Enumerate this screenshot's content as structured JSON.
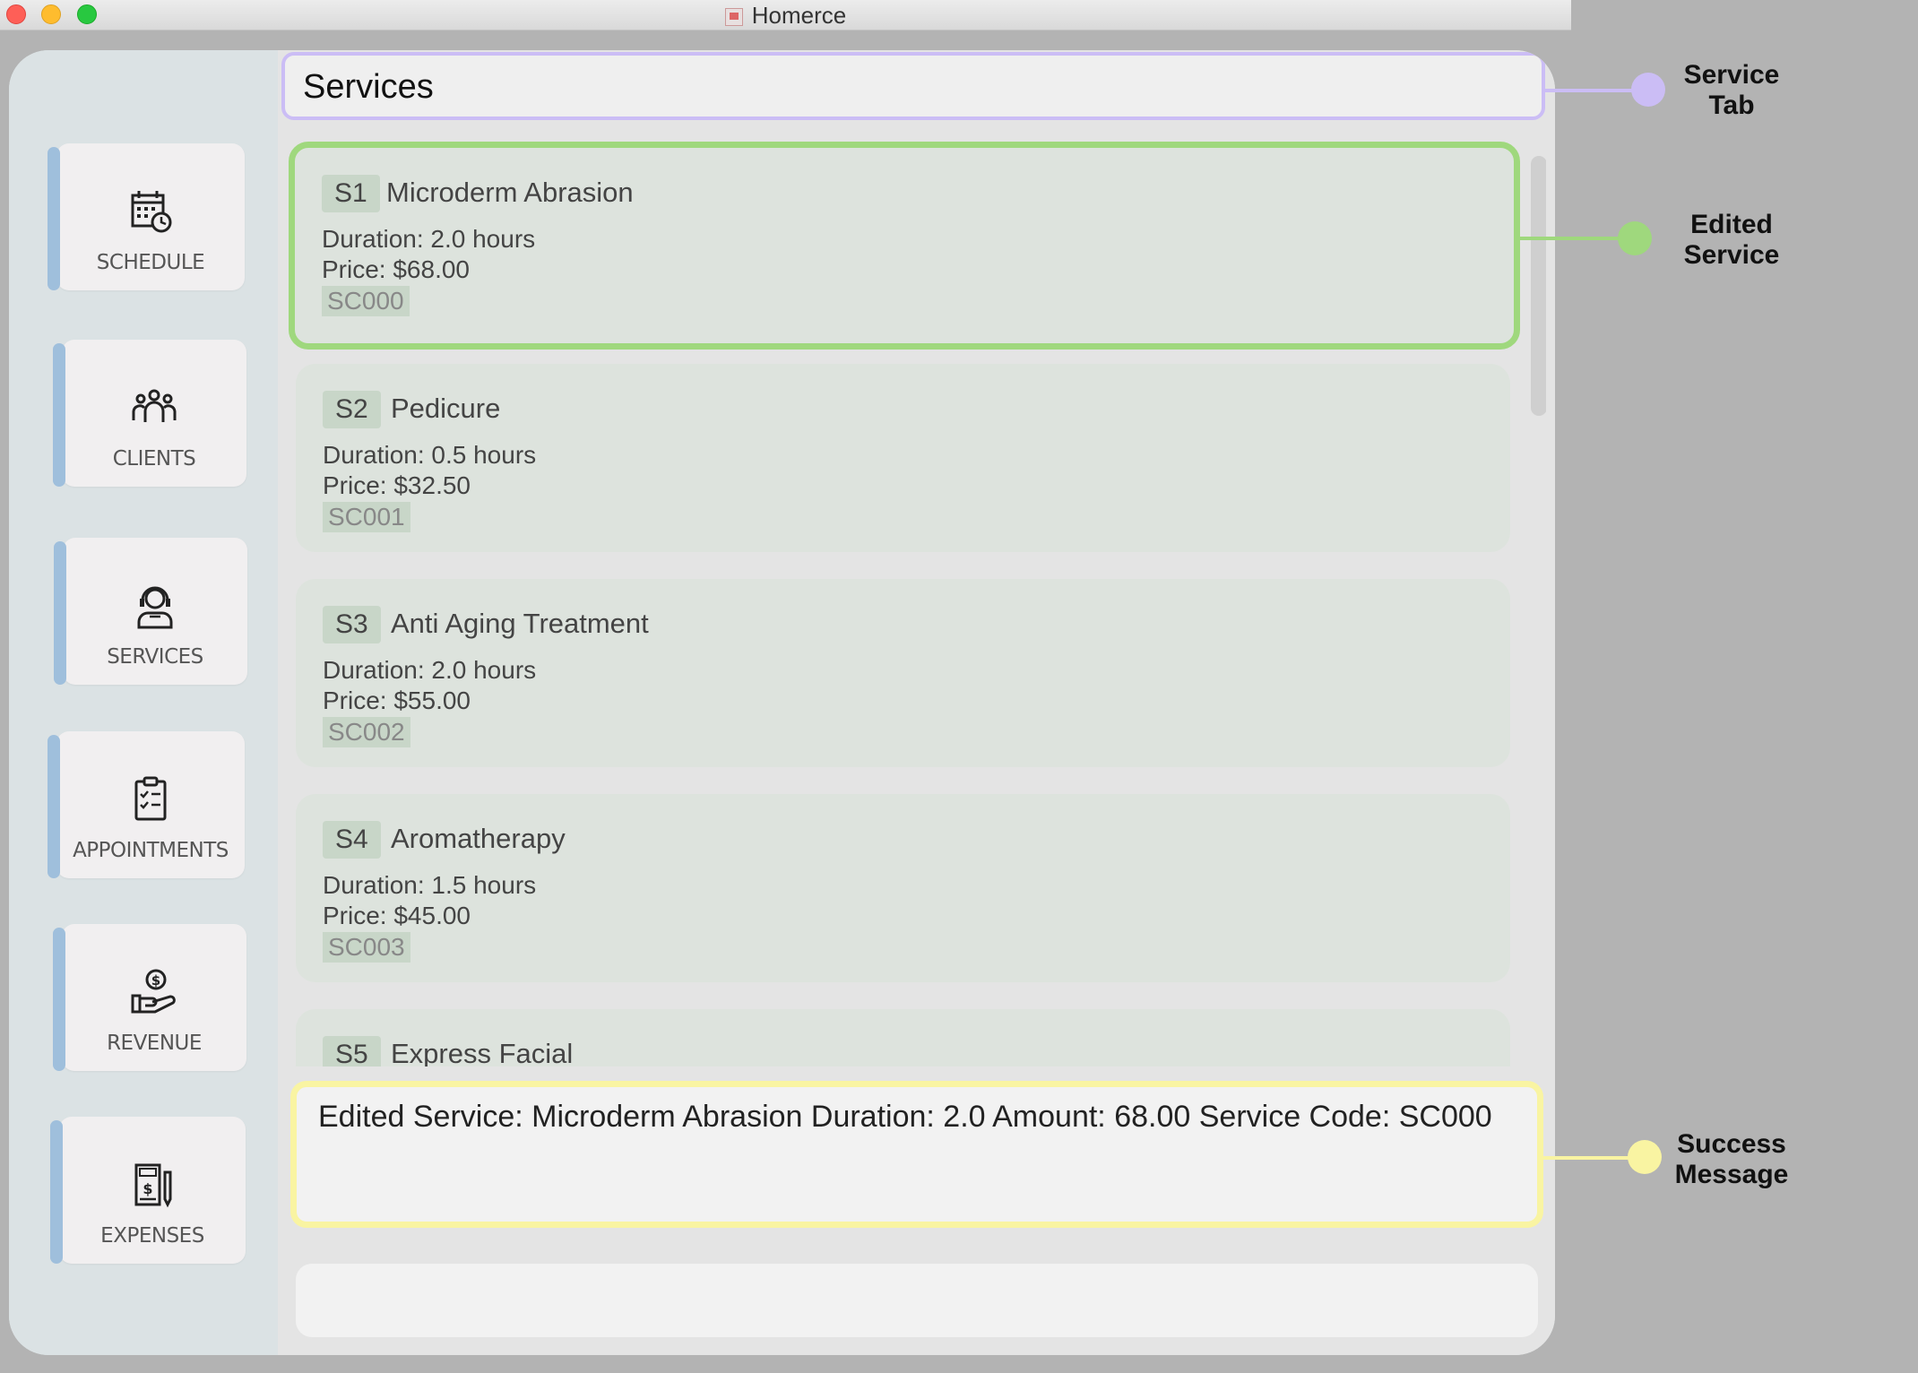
{
  "window": {
    "title": "Homerce"
  },
  "sidebar": {
    "items": [
      {
        "label": "SCHEDULE",
        "icon": "calendar-icon"
      },
      {
        "label": "CLIENTS",
        "icon": "people-icon"
      },
      {
        "label": "SERVICES",
        "icon": "support-agent-icon"
      },
      {
        "label": "APPOINTMENTS",
        "icon": "checklist-icon"
      },
      {
        "label": "REVENUE",
        "icon": "money-hand-icon"
      },
      {
        "label": "EXPENSES",
        "icon": "receipt-icon"
      }
    ]
  },
  "main": {
    "tab_title": "Services",
    "services": [
      {
        "index": "S1",
        "name": "Microderm Abrasion",
        "duration": "Duration: 2.0 hours",
        "price": "Price: $68.00",
        "code": "SC000"
      },
      {
        "index": "S2",
        "name": "Pedicure",
        "duration": "Duration: 0.5 hours",
        "price": "Price: $32.50",
        "code": "SC001"
      },
      {
        "index": "S3",
        "name": "Anti Aging Treatment",
        "duration": "Duration: 2.0 hours",
        "price": "Price: $55.00",
        "code": "SC002"
      },
      {
        "index": "S4",
        "name": "Aromatherapy",
        "duration": "Duration: 1.5 hours",
        "price": "Price: $45.00",
        "code": "SC003"
      },
      {
        "index": "S5",
        "name": "Express Facial",
        "duration": "",
        "price": "",
        "code": ""
      }
    ],
    "result_message": "Edited Service: Microderm Abrasion Duration: 2.0 Amount: 68.00 Service Code: SC000",
    "command_input": ""
  },
  "annotations": {
    "service_tab": {
      "line1": "Service",
      "line2": "Tab",
      "color": "#cbbdf5"
    },
    "edited_service": {
      "line1": "Edited",
      "line2": "Service",
      "color": "#9fd87d"
    },
    "success_message": {
      "line1": "Success",
      "line2": "Message",
      "color": "#f9f4a2"
    }
  }
}
